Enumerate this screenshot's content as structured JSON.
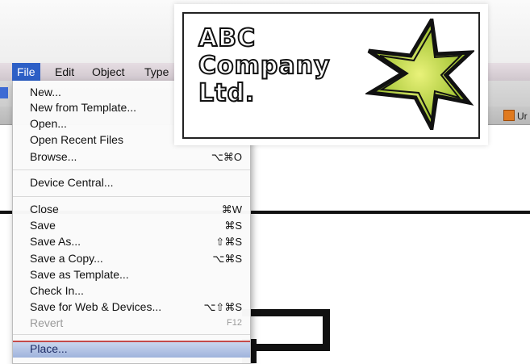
{
  "menubar": {
    "items": [
      "File",
      "Edit",
      "Object",
      "Type"
    ],
    "active": "File"
  },
  "right_tab": {
    "label": "Ur"
  },
  "file_menu": {
    "items": [
      {
        "label": "New...",
        "shortcut": ""
      },
      {
        "label": "New from Template...",
        "shortcut": ""
      },
      {
        "label": "Open...",
        "shortcut": ""
      },
      {
        "label": "Open Recent Files",
        "shortcut": ""
      },
      {
        "label": "Browse...",
        "shortcut": "⌥⌘O"
      },
      {
        "label": "Device Central...",
        "shortcut": ""
      },
      {
        "label": "Close",
        "shortcut": "⌘W"
      },
      {
        "label": "Save",
        "shortcut": "⌘S"
      },
      {
        "label": "Save As...",
        "shortcut": "⇧⌘S"
      },
      {
        "label": "Save a Copy...",
        "shortcut": "⌥⌘S"
      },
      {
        "label": "Save as Template...",
        "shortcut": ""
      },
      {
        "label": "Check In...",
        "shortcut": ""
      },
      {
        "label": "Save for Web & Devices...",
        "shortcut": "⌥⇧⌘S"
      },
      {
        "label": "Revert",
        "shortcut": "F12",
        "disabled": true
      },
      {
        "label": "Place...",
        "shortcut": "",
        "highlighted": true
      }
    ]
  },
  "logo": {
    "line1": "ABC",
    "line2": "Company",
    "line3": "Ltd.",
    "star_color": "#9bc12a"
  }
}
